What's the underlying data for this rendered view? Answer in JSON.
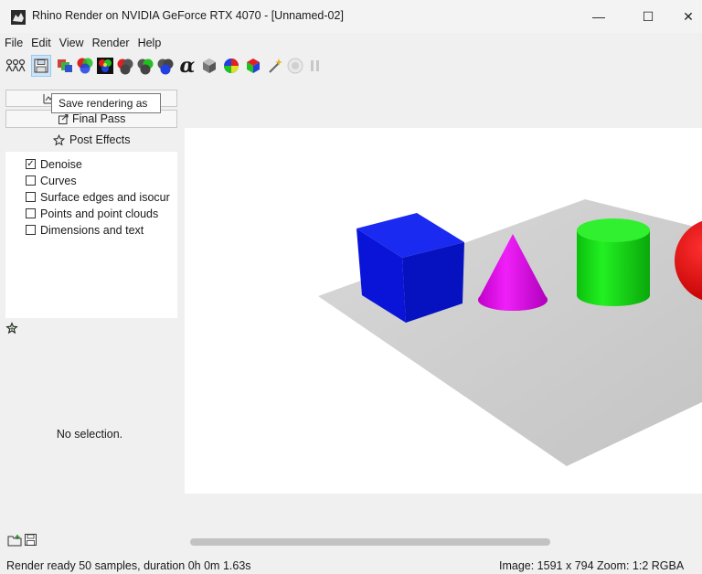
{
  "window": {
    "title": "Rhino Render on NVIDIA GeForce RTX 4070 - [Unnamed-02]",
    "app_icon": "rhino-icon",
    "controls": {
      "minimize": "—",
      "maximize": "☐",
      "close": "✕"
    }
  },
  "menu": [
    "File",
    "Edit",
    "View",
    "Render",
    "Help"
  ],
  "toolbar": {
    "icons": [
      "channels-icon",
      "save-rendering-icon",
      "copy-image-icon",
      "color-channels-icon",
      "ao-icon",
      "red-channel-icon",
      "green-channel-icon",
      "blue-channel-icon",
      "alpha-icon",
      "depth-icon",
      "normal-icon",
      "material-id-icon",
      "magic-wand-icon",
      "stop-icon",
      "pause-icon"
    ],
    "alpha_glyph": "α",
    "tooltip": "Save rendering as"
  },
  "left_panel": {
    "tabs": {
      "final_pass": "Final Pass"
    },
    "post_effects_header": "Post Effects",
    "post_effects": [
      {
        "label": "Denoise",
        "checked": true
      },
      {
        "label": "Curves",
        "checked": false
      },
      {
        "label": "Surface edges and isocur",
        "checked": false
      },
      {
        "label": "Points and point clouds",
        "checked": false
      },
      {
        "label": "Dimensions and text",
        "checked": false
      }
    ],
    "no_selection": "No selection."
  },
  "scene": {
    "objects": [
      "blue-cube",
      "magenta-cone",
      "green-cylinder",
      "red-sphere"
    ],
    "colors": {
      "cube": "#0a14e0",
      "cone": "#e000e8",
      "cylinder": "#10e010",
      "sphere": "#ee0a0a",
      "plane": "#c8c8c8"
    }
  },
  "status": {
    "left": "Render ready 50 samples, duration 0h 0m 1.63s",
    "right": "Image: 1591 x 794  Zoom: 1:2  RGBA"
  }
}
